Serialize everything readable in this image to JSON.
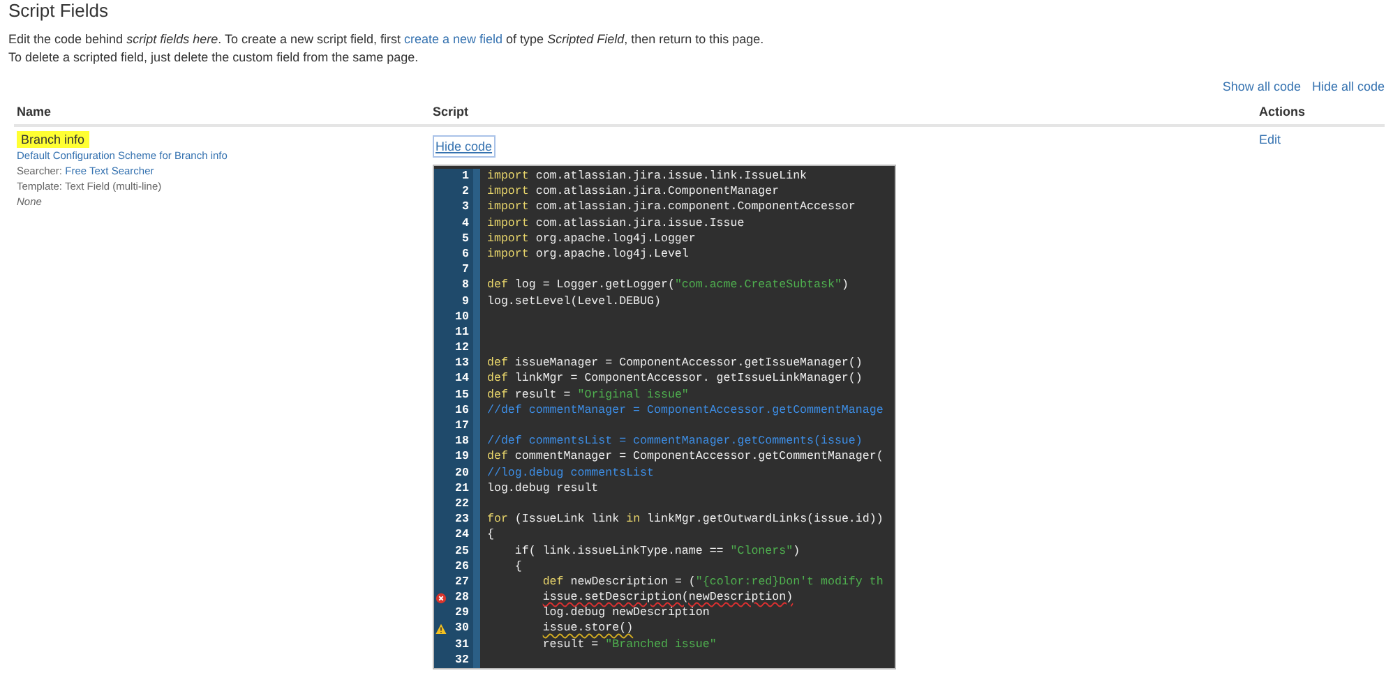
{
  "title": "Script Fields",
  "intro": [
    "Edit the code behind *script fields here*. To create a new script field, first ",
    "create a new field",
    " of type *Scripted Field*, then return to this page."
  ],
  "intro_line2": "To delete a scripted field, just delete the custom field from the same page.",
  "code_links": [
    "Show all code",
    "Hide all code"
  ],
  "table": {
    "columns": [
      "Name",
      "Script",
      "Actions"
    ],
    "rows": [
      {
        "name": "Branch info",
        "highlighted": true,
        "scheme_link": "Default Configuration Scheme for Branch info",
        "searcher_label": "Searcher:",
        "searcher": "Free Text Searcher",
        "template": "Template: Text Field (multi-line)",
        "note": "None",
        "toggle": "Hide code",
        "action": "Edit",
        "code": [
          {
            "n": "1",
            "tokens": [
              {
                "kind": "kw",
                "text": "import"
              },
              {
                "kind": "plain",
                "text": " com.atlassian.jira.issue.link.IssueLink"
              }
            ]
          },
          {
            "n": "2",
            "tokens": [
              {
                "kind": "kw",
                "text": "import"
              },
              {
                "kind": "plain",
                "text": " com.atlassian.jira.ComponentManager"
              }
            ]
          },
          {
            "n": "3",
            "tokens": [
              {
                "kind": "kw",
                "text": "import"
              },
              {
                "kind": "plain",
                "text": " com.atlassian.jira.component.ComponentAccessor"
              }
            ]
          },
          {
            "n": "4",
            "tokens": [
              {
                "kind": "kw",
                "text": "import"
              },
              {
                "kind": "plain",
                "text": " com.atlassian.jira.issue.Issue"
              }
            ]
          },
          {
            "n": "5",
            "tokens": [
              {
                "kind": "kw",
                "text": "import"
              },
              {
                "kind": "plain",
                "text": " org.apache.log4j.Logger"
              }
            ]
          },
          {
            "n": "6",
            "tokens": [
              {
                "kind": "kw",
                "text": "import"
              },
              {
                "kind": "plain",
                "text": " org.apache.log4j.Level"
              }
            ]
          },
          {
            "n": "7"
          },
          {
            "n": "8",
            "tokens": [
              {
                "kind": "kw",
                "text": "def"
              },
              {
                "kind": "plain",
                "text": " log = Logger.getLogger("
              },
              {
                "kind": "str",
                "text": "\"com.acme.CreateSubtask\""
              },
              {
                "kind": "plain",
                "text": ")"
              }
            ]
          },
          {
            "n": "9",
            "tokens": [
              {
                "kind": "plain",
                "text": "log.setLevel(Level.DEBUG)"
              }
            ]
          },
          {
            "n": "10"
          },
          {
            "n": "11"
          },
          {
            "n": "12"
          },
          {
            "n": "13",
            "tokens": [
              {
                "kind": "kw",
                "text": "def"
              },
              {
                "kind": "plain",
                "text": " issueManager = ComponentAccessor.getIssueManager()"
              }
            ]
          },
          {
            "n": "14",
            "tokens": [
              {
                "kind": "kw",
                "text": "def"
              },
              {
                "kind": "plain",
                "text": " linkMgr = ComponentAccessor. getIssueLinkManager()"
              }
            ]
          },
          {
            "n": "15",
            "tokens": [
              {
                "kind": "kw",
                "text": "def"
              },
              {
                "kind": "plain",
                "text": " result = "
              },
              {
                "kind": "str",
                "text": "\"Original issue\""
              }
            ]
          },
          {
            "n": "16",
            "tokens": [
              {
                "kind": "comment",
                "text": "//def commentManager = ComponentAccessor.getCommentManage"
              }
            ]
          },
          {
            "n": "17"
          },
          {
            "n": "18",
            "tokens": [
              {
                "kind": "comment",
                "text": "//def commentsList = commentManager.getComments(issue)"
              }
            ]
          },
          {
            "n": "19",
            "tokens": [
              {
                "kind": "kw",
                "text": "def"
              },
              {
                "kind": "plain",
                "text": " commentManager = ComponentAccessor.getCommentManager("
              }
            ]
          },
          {
            "n": "20",
            "tokens": [
              {
                "kind": "comment",
                "text": "//log.debug commentsList"
              }
            ]
          },
          {
            "n": "21",
            "tokens": [
              {
                "kind": "plain",
                "text": "log.debug result"
              }
            ]
          },
          {
            "n": "22"
          },
          {
            "n": "23",
            "tokens": [
              {
                "kind": "kw",
                "text": "for"
              },
              {
                "kind": "plain",
                "text": " (IssueLink link "
              },
              {
                "kind": "kw",
                "text": "in"
              },
              {
                "kind": "plain",
                "text": " linkMgr.getOutwardLinks(issue.id))"
              }
            ]
          },
          {
            "n": "24",
            "tokens": [
              {
                "kind": "plain",
                "text": "{"
              }
            ]
          },
          {
            "n": "25",
            "tokens": [
              {
                "kind": "plain",
                "text": "    if( link.issueLinkType.name == "
              },
              {
                "kind": "str",
                "text": "\"Cloners\""
              },
              {
                "kind": "plain",
                "text": ")"
              }
            ]
          },
          {
            "n": "26",
            "tokens": [
              {
                "kind": "plain",
                "text": "    {"
              }
            ]
          },
          {
            "n": "27",
            "tokens": [
              {
                "kind": "kw",
                "text": "        def"
              },
              {
                "kind": "plain",
                "text": " newDescription = ("
              },
              {
                "kind": "str",
                "text": "\"{color:red}Don't modify th"
              }
            ]
          },
          {
            "n": "28",
            "error": true,
            "tokens": [
              {
                "kind": "error",
                "text": "        issue.setDescription(newDescription)"
              }
            ]
          },
          {
            "n": "29",
            "tokens": [
              {
                "kind": "plain",
                "text": "        log.debug newDescription"
              }
            ]
          },
          {
            "n": "30",
            "warning": true,
            "tokens": [
              {
                "kind": "warning",
                "text": "        issue.store()"
              }
            ]
          },
          {
            "n": "31",
            "tokens": [
              {
                "kind": "plain",
                "text": "        result = "
              },
              {
                "kind": "str",
                "text": "\"Branched issue\""
              }
            ]
          },
          {
            "n": "32"
          }
        ]
      }
    ]
  }
}
